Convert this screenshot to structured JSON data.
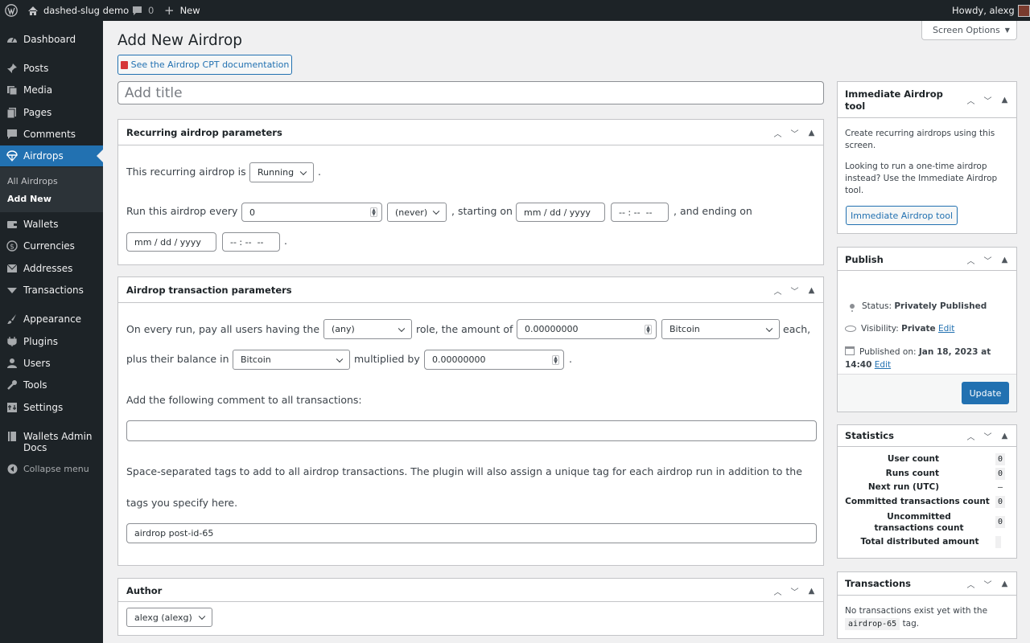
{
  "admin_bar": {
    "site_name": "dashed-slug demo",
    "comments_count": "0",
    "new_label": "New",
    "greeting": "Howdy, alexg"
  },
  "sidebar": {
    "items": [
      {
        "label": "Dashboard",
        "icon": "dashboard-icon"
      },
      {
        "label": "Posts",
        "icon": "pin-icon"
      },
      {
        "label": "Media",
        "icon": "media-icon"
      },
      {
        "label": "Pages",
        "icon": "pages-icon"
      },
      {
        "label": "Comments",
        "icon": "comment-icon"
      },
      {
        "label": "Airdrops",
        "icon": "airdrop-icon"
      },
      {
        "label": "Wallets",
        "icon": "wallet-icon"
      },
      {
        "label": "Currencies",
        "icon": "currency-icon"
      },
      {
        "label": "Addresses",
        "icon": "address-icon"
      },
      {
        "label": "Transactions",
        "icon": "transactions-icon"
      },
      {
        "label": "Appearance",
        "icon": "brush-icon"
      },
      {
        "label": "Plugins",
        "icon": "plugin-icon"
      },
      {
        "label": "Users",
        "icon": "users-icon"
      },
      {
        "label": "Tools",
        "icon": "wrench-icon"
      },
      {
        "label": "Settings",
        "icon": "settings-icon"
      },
      {
        "label": "Wallets Admin Docs",
        "icon": "book-icon"
      }
    ],
    "submenu": [
      "All Airdrops",
      "Add New"
    ],
    "collapse_label": "Collapse menu"
  },
  "page": {
    "title": "Add New Airdrop",
    "screen_options": "Screen Options",
    "doc_button": "See the Airdrop CPT documentation",
    "title_placeholder": "Add title"
  },
  "recurring": {
    "heading": "Recurring airdrop parameters",
    "line1_prefix": "This recurring airdrop is",
    "status_value": "Running",
    "line1_suffix": ".",
    "run_every_label": "Run this airdrop every",
    "interval_value": "0",
    "interval_unit": "(never)",
    "starting_on": ", starting on",
    "date_placeholder": "mm / dd / yyyy",
    "time_placeholder": "-- : --  --",
    "ending_on": ", and ending on",
    "end_date_placeholder": "mm / dd / yyyy",
    "end_time_placeholder": "-- : --  --",
    "end_suffix": "."
  },
  "transaction": {
    "heading": "Airdrop transaction parameters",
    "on_every_run": "On every run, pay all users having the",
    "role_value": "(any)",
    "role_amount": "role, the amount of",
    "amount_value": "0.00000000",
    "currency_value": "Bitcoin",
    "each": "each,",
    "plus_balance": "plus their balance in",
    "balance_currency": "Bitcoin",
    "multiplied_by": "multiplied by",
    "multiplier_value": "0.00000000",
    "end_dot": ".",
    "comment_label": "Add the following comment to all transactions:",
    "comment_value": "",
    "tags_label_1": "Space-separated tags to add to all airdrop transactions. The plugin will also assign a unique tag for each airdrop run in addition to the",
    "tags_label_2": "tags you specify here.",
    "tags_value": "airdrop post-id-65"
  },
  "author": {
    "heading": "Author",
    "value": "alexg (alexg)"
  },
  "immediate": {
    "heading": "Immediate Airdrop tool",
    "p1": "Create recurring airdrops using this screen.",
    "p2": "Looking to run a one-time airdrop instead? Use the Immediate Airdrop tool.",
    "button": "Immediate Airdrop tool"
  },
  "publish": {
    "heading": "Publish",
    "status_label": "Status:",
    "status_value": "Privately Published",
    "visibility_label": "Visibility:",
    "visibility_value": "Private",
    "edit1": "Edit",
    "published_label": "Published on:",
    "published_value": "Jan 18, 2023 at 14:40",
    "edit2": "Edit",
    "update_button": "Update"
  },
  "statistics": {
    "heading": "Statistics",
    "rows": [
      {
        "label": "User count",
        "value": "0"
      },
      {
        "label": "Runs count",
        "value": "0"
      },
      {
        "label": "Next run (UTC)",
        "value": "—"
      },
      {
        "label": "Committed transactions count",
        "value": "0"
      },
      {
        "label": "Uncommitted transactions count",
        "value": "0"
      },
      {
        "label": "Total distributed amount",
        "value": ""
      }
    ]
  },
  "transactions_box": {
    "heading": "Transactions",
    "text_prefix": "No transactions exist yet with the",
    "tag": "airdrop-65",
    "text_suffix": "tag."
  },
  "colors": {
    "accent": "#2271b1",
    "admin_bg": "#1d2327"
  }
}
